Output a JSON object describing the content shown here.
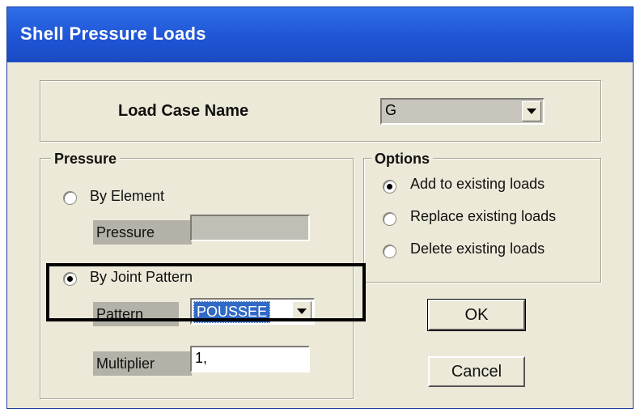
{
  "window": {
    "title": "Shell Pressure Loads"
  },
  "load_case": {
    "label": "Load Case Name",
    "value": "G"
  },
  "pressure": {
    "group_title": "Pressure",
    "by_element_label": "By Element",
    "pressure_label": "Pressure",
    "pressure_value": "",
    "by_joint_pattern_label": "By Joint Pattern",
    "pattern_label": "Pattern",
    "pattern_value": "POUSSEE",
    "multiplier_label": "Multiplier",
    "multiplier_value": "1,",
    "selected": "by_joint_pattern"
  },
  "options": {
    "group_title": "Options",
    "add_label": "Add to existing loads",
    "replace_label": "Replace existing loads",
    "delete_label": "Delete existing loads",
    "selected": "add"
  },
  "buttons": {
    "ok_label": "OK",
    "cancel_label": "Cancel"
  },
  "colors": {
    "titlebar": "#1f55d6",
    "dialog_bg": "#ece9d8",
    "selection": "#316ac5"
  }
}
